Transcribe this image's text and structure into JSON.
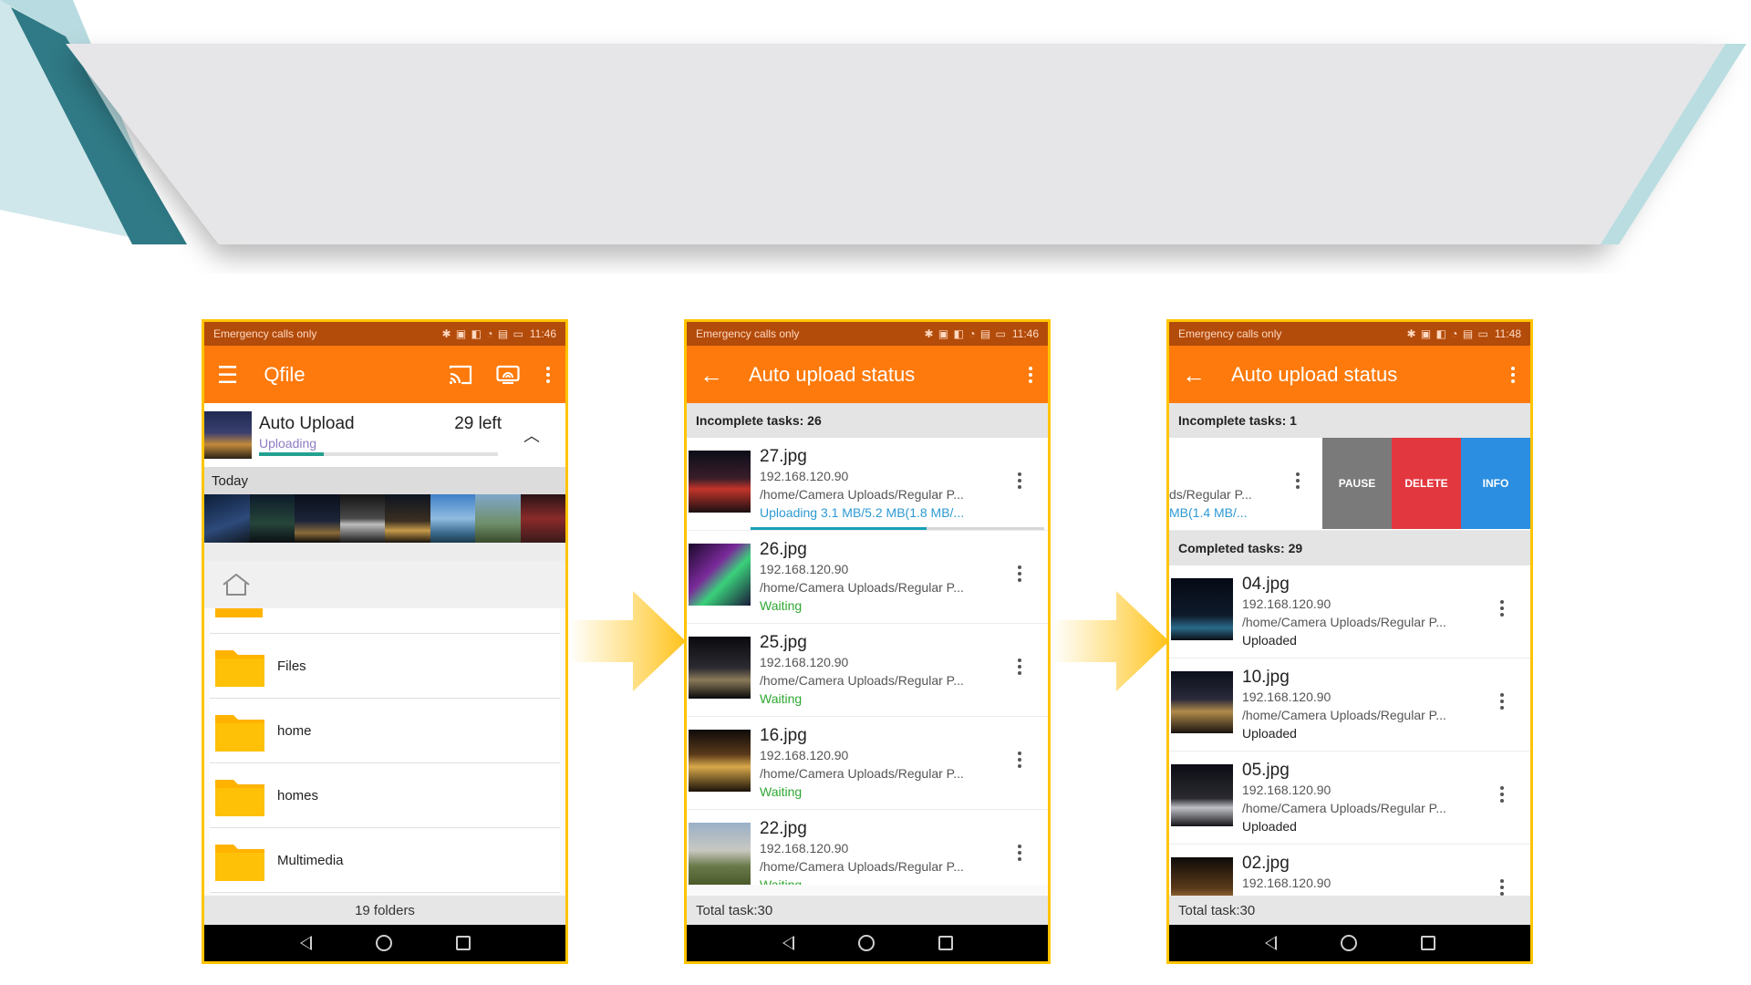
{
  "colors": {
    "accent_orange": "#fe7a0c",
    "status_bar": "#b34b0a",
    "frame_yellow": "#ffc400",
    "waiting_green": "#2fa832",
    "uploading_blue": "#2d9ad4",
    "delete_red": "#e2373f",
    "info_blue": "#2b8ee0",
    "pause_gray": "#7a7a7a"
  },
  "phone1": {
    "status": {
      "carrier": "Emergency calls only",
      "icons": "✱ ▣ ◧ ◔ ▤ ▭",
      "time": "11:46"
    },
    "appbar": {
      "title": "Qfile",
      "menu_icon": "menu-icon",
      "cast_icon": "cast-icon",
      "screen_icon": "screen-cast-icon"
    },
    "auto_upload": {
      "title": "Auto Upload",
      "status": "Uploading",
      "left": "29 left",
      "progress": 0.27
    },
    "today_label": "Today",
    "folders": [
      {
        "label": "Files"
      },
      {
        "label": "home"
      },
      {
        "label": "homes"
      },
      {
        "label": "Multimedia"
      }
    ],
    "footer": "19 folders"
  },
  "phone2": {
    "status": {
      "carrier": "Emergency calls only",
      "icons": "✱ ▣ ◧ ◔ ▤ ▭",
      "time": "11:46"
    },
    "appbar": {
      "title": "Auto upload status"
    },
    "incomplete_label": "Incomplete tasks: 26",
    "tasks": [
      {
        "name": "27.jpg",
        "ip": "192.168.120.90",
        "path": "/home/Camera Uploads/Regular P...",
        "status": "Uploading  3.1 MB/5.2 MB(1.8 MB/...",
        "progress": 0.6
      },
      {
        "name": "26.jpg",
        "ip": "192.168.120.90",
        "path": "/home/Camera Uploads/Regular P...",
        "status": "Waiting"
      },
      {
        "name": "25.jpg",
        "ip": "192.168.120.90",
        "path": "/home/Camera Uploads/Regular P...",
        "status": "Waiting"
      },
      {
        "name": "16.jpg",
        "ip": "192.168.120.90",
        "path": "/home/Camera Uploads/Regular P...",
        "status": "Waiting"
      },
      {
        "name": "22.jpg",
        "ip": "192.168.120.90",
        "path": "/home/Camera Uploads/Regular P...",
        "status": "Waiting"
      }
    ],
    "footer": "Total task:30"
  },
  "phone3": {
    "status": {
      "carrier": "Emergency calls only",
      "icons": "✱ ▣ ◧ ◔ ▤ ▭",
      "time": "11:48"
    },
    "appbar": {
      "title": "Auto upload status"
    },
    "incomplete_label": "Incomplete tasks: 1",
    "swipe_row": {
      "path_partial": "ds/Regular P...",
      "status_partial": "MB(1.4 MB/...",
      "pause": "PAUSE",
      "delete": "DELETE",
      "info": "INFO"
    },
    "completed_label": "Completed tasks: 29",
    "tasks": [
      {
        "name": "04.jpg",
        "ip": "192.168.120.90",
        "path": "/home/Camera Uploads/Regular P...",
        "status": "Uploaded"
      },
      {
        "name": "10.jpg",
        "ip": "192.168.120.90",
        "path": "/home/Camera Uploads/Regular P...",
        "status": "Uploaded"
      },
      {
        "name": "05.jpg",
        "ip": "192.168.120.90",
        "path": "/home/Camera Uploads/Regular P...",
        "status": "Uploaded"
      },
      {
        "name": "02.jpg",
        "ip": "192.168.120.90",
        "path": "",
        "status": ""
      }
    ],
    "footer": "Total task:30"
  }
}
